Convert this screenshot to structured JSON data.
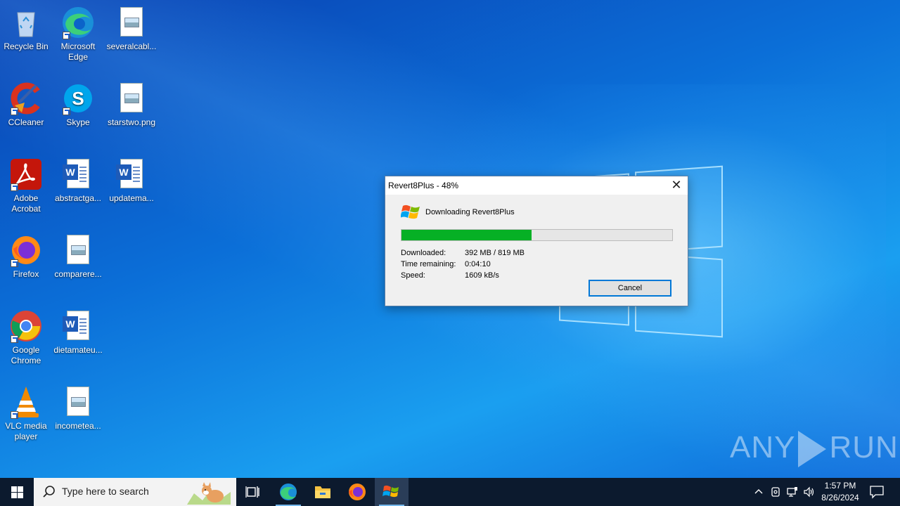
{
  "desktop": {
    "icons": [
      {
        "label": "Recycle Bin",
        "icon": "recycle-bin-icon"
      },
      {
        "label": "Microsoft Edge",
        "icon": "edge-icon"
      },
      {
        "label": "severalcabl...",
        "icon": "image-file-icon"
      },
      {
        "label": "CCleaner",
        "icon": "ccleaner-icon"
      },
      {
        "label": "Skype",
        "icon": "skype-icon"
      },
      {
        "label": "starstwo.png",
        "icon": "image-file-icon"
      },
      {
        "label": "Adobe Acrobat",
        "icon": "acrobat-icon"
      },
      {
        "label": "abstractga...",
        "icon": "word-doc-icon"
      },
      {
        "label": "updatema...",
        "icon": "word-doc-icon"
      },
      {
        "label": "Firefox",
        "icon": "firefox-icon"
      },
      {
        "label": "comparere...",
        "icon": "image-file-icon"
      },
      {
        "label": "Google Chrome",
        "icon": "chrome-icon"
      },
      {
        "label": "dietamateu...",
        "icon": "word-doc-icon"
      },
      {
        "label": "VLC media player",
        "icon": "vlc-icon"
      },
      {
        "label": "incometea...",
        "icon": "image-file-icon"
      }
    ]
  },
  "dialog": {
    "title": "Revert8Plus - 48%",
    "heading": "Downloading Revert8Plus",
    "progress_fraction": 0.48,
    "downloaded_label": "Downloaded:",
    "downloaded_value": "392 MB / 819 MB",
    "time_label": "Time remaining:",
    "time_value": "0:04:10",
    "speed_label": "Speed:",
    "speed_value": "1609 kB/s",
    "cancel_label": "Cancel",
    "close_glyph": "✕"
  },
  "watermark": {
    "left": "ANY",
    "right": "RUN"
  },
  "taskbar": {
    "search_placeholder": "Type here to search",
    "pinned": [
      "task-view-icon",
      "edge-icon",
      "file-explorer-icon",
      "firefox-icon",
      "revert8plus-icon"
    ],
    "clock_time": "1:57 PM",
    "clock_date": "8/26/2024"
  },
  "colors": {
    "progress_fill": "#06b025",
    "taskbar": "#0c1a2e",
    "focus_border": "#0078d7"
  }
}
